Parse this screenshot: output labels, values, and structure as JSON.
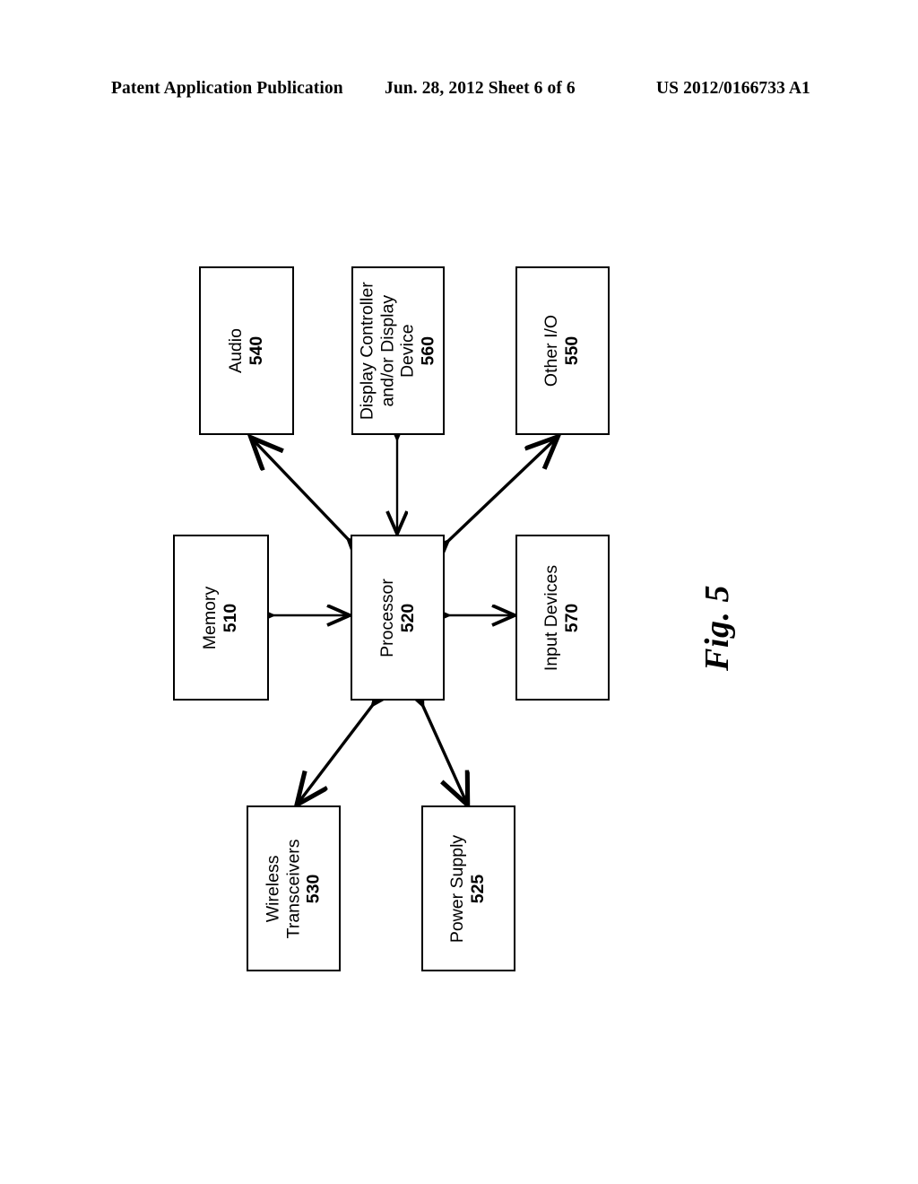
{
  "header": {
    "left": "Patent Application Publication",
    "center": "Jun. 28, 2012  Sheet 6 of 6",
    "right": "US 2012/0166733 A1"
  },
  "figure": {
    "caption": "Fig. 5"
  },
  "diagram": {
    "type": "block-diagram",
    "orientation": "rotated-90-ccw",
    "boxes": [
      {
        "id": "audio",
        "label": "Audio",
        "number": "540"
      },
      {
        "id": "display",
        "label": "Display Controller\nand/or Display\nDevice",
        "line1": "Display Controller",
        "line2": "and/or Display",
        "line3": "Device",
        "number": "560"
      },
      {
        "id": "otherio",
        "label": "Other I/O",
        "number": "550"
      },
      {
        "id": "memory",
        "label": "Memory",
        "number": "510"
      },
      {
        "id": "processor",
        "label": "Processor",
        "number": "520"
      },
      {
        "id": "input",
        "label": "Input Devices",
        "number": "570"
      },
      {
        "id": "wireless",
        "label": "Wireless\nTransceivers",
        "line1": "Wireless",
        "line2": "Transceivers",
        "number": "530"
      },
      {
        "id": "power",
        "label": "Power Supply",
        "number": "525"
      }
    ],
    "connections": [
      {
        "from": "processor",
        "to": "audio",
        "style": "double-arrow",
        "path": "diagonal"
      },
      {
        "from": "processor",
        "to": "display",
        "style": "double-arrow",
        "path": "vertical"
      },
      {
        "from": "processor",
        "to": "otherio",
        "style": "double-arrow",
        "path": "diagonal"
      },
      {
        "from": "processor",
        "to": "memory",
        "style": "double-arrow",
        "path": "horizontal"
      },
      {
        "from": "processor",
        "to": "input",
        "style": "double-arrow",
        "path": "horizontal"
      },
      {
        "from": "processor",
        "to": "wireless",
        "style": "double-arrow",
        "path": "diagonal"
      },
      {
        "from": "processor",
        "to": "power",
        "style": "double-arrow",
        "path": "diagonal"
      }
    ]
  },
  "colors": {
    "ink": "#000000",
    "paper": "#ffffff"
  }
}
